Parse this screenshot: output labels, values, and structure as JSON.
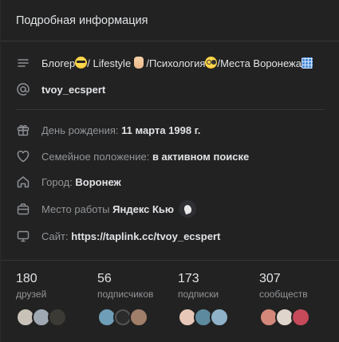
{
  "header": {
    "title": "Подробная информация"
  },
  "bio": {
    "parts": [
      "Блогер",
      "/ Lifestyle",
      " /Психология",
      "/Места Воронежа"
    ]
  },
  "nickname": "tvoy_ecspert",
  "details": {
    "birthday": {
      "label": "День рождения:",
      "value": "11 марта 1998 г."
    },
    "relationship": {
      "label": "Семейное положение:",
      "value": "в активном поиске"
    },
    "city": {
      "label": "Город:",
      "value": "Воронеж"
    },
    "work": {
      "label": "Место работы",
      "value": "Яндекс Кью"
    },
    "site": {
      "label": "Сайт:",
      "value": "https://taplink.cc/tvoy_ecspert"
    }
  },
  "stats": [
    {
      "count": "180",
      "caption": "друзей",
      "avatar_colors": [
        "#c8c2b8",
        "#9fa8b3",
        "#3c3a34"
      ]
    },
    {
      "count": "56",
      "caption": "подписчиков",
      "avatar_colors": [
        "#6f9fb8",
        "#2b2b2b",
        "#a07f6a"
      ]
    },
    {
      "count": "173",
      "caption": "подписки",
      "avatar_colors": [
        "#e7c7b8",
        "#5d8a9e",
        "#8fb2c9"
      ]
    },
    {
      "count": "307",
      "caption": "сообществ",
      "avatar_colors": [
        "#d4887a",
        "#e0d5cc",
        "#c64a5a"
      ]
    }
  ],
  "colors": {
    "background": "#222222",
    "text": "#e1e3e6",
    "muted": "#929599",
    "divider": "#363738"
  }
}
